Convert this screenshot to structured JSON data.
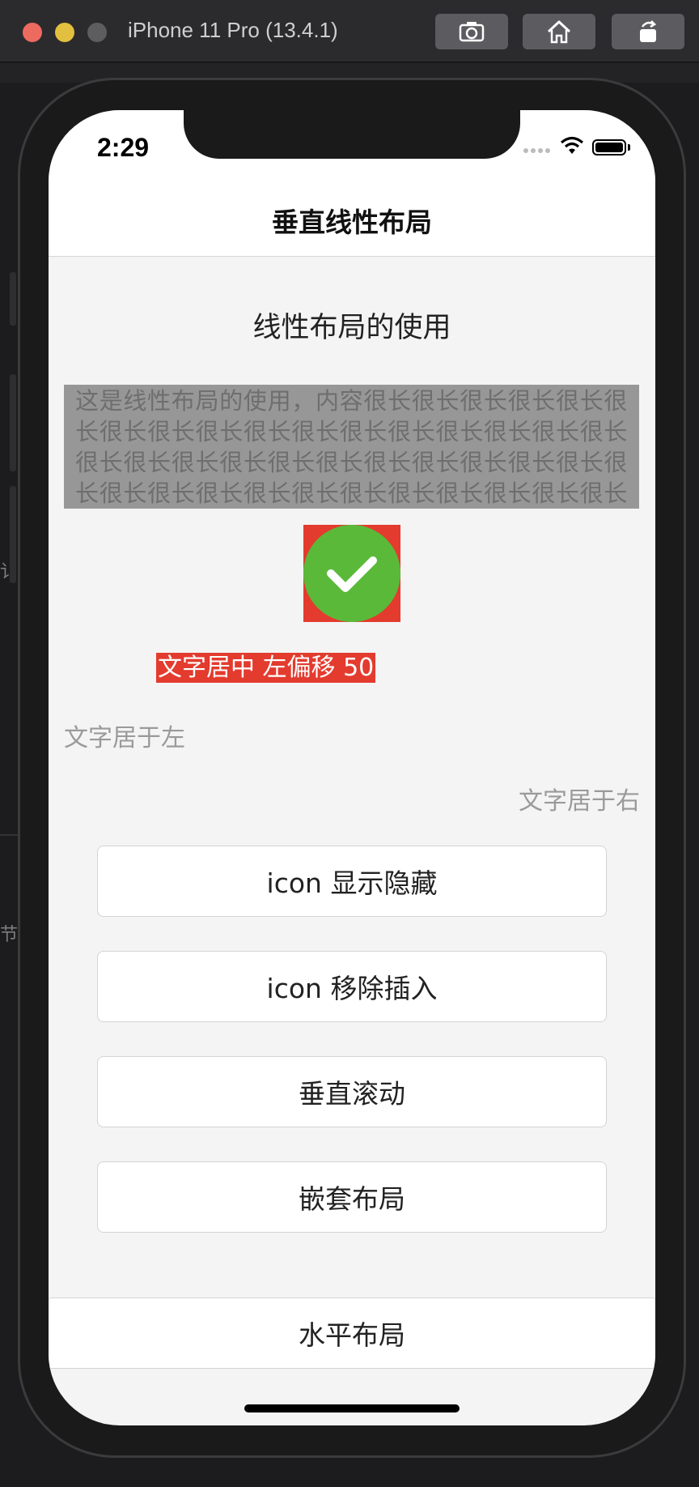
{
  "simulator": {
    "title": "iPhone 11 Pro (13.4.1)",
    "buttons": [
      "screenshot-icon",
      "home-icon",
      "rotate-icon"
    ]
  },
  "background": {
    "side_chars": [
      "讠",
      "节"
    ]
  },
  "status_bar": {
    "time": "2:29"
  },
  "nav": {
    "title": "垂直线性布局"
  },
  "content": {
    "section_title": "线性布局的使用",
    "long_text": "这是线性布局的使用，内容很长很长很长很长很长很长很长很长很长很长很长很长很长很长很长很长很长很长很长很长很长很长很长很长很长很长很长很长很长很长很长很长很长很长很长很长很长很长很长很长很长很长",
    "icon": "check-circle-icon",
    "centered_label": "文字居中 左偏移 50",
    "left_label": "文字居于左",
    "right_label": "文字居于右"
  },
  "buttons": [
    {
      "label": "icon 显示隐藏"
    },
    {
      "label": "icon 移除插入"
    },
    {
      "label": "垂直滚动"
    },
    {
      "label": "嵌套布局"
    }
  ],
  "bottom_button": {
    "label": "水平布局"
  },
  "colors": {
    "accent_red": "#e33b2e",
    "check_green": "#5bb93a",
    "text_block_bg": "#979797"
  }
}
